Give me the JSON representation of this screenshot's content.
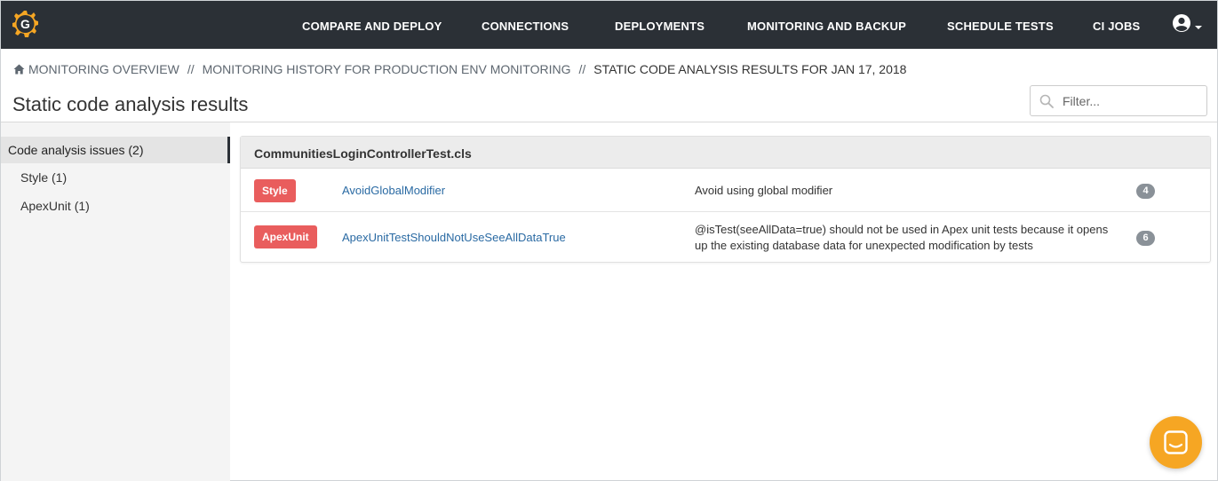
{
  "brand": {
    "logo_letter": "G",
    "logo_color": "#f6a623"
  },
  "nav": {
    "items": [
      {
        "label": "COMPARE AND DEPLOY"
      },
      {
        "label": "CONNECTIONS"
      },
      {
        "label": "DEPLOYMENTS"
      },
      {
        "label": "MONITORING AND BACKUP"
      },
      {
        "label": "SCHEDULE TESTS"
      },
      {
        "label": "CI JOBS"
      }
    ],
    "user_icon": "user-circle-icon"
  },
  "breadcrumb": {
    "items": [
      {
        "label": "MONITORING OVERVIEW"
      },
      {
        "label": "MONITORING HISTORY FOR PRODUCTION ENV MONITORING"
      }
    ],
    "separator": "//",
    "current": "STATIC CODE ANALYSIS RESULTS FOR JAN 17, 2018"
  },
  "page": {
    "title": "Static code analysis results"
  },
  "filter": {
    "placeholder": "Filter..."
  },
  "sidebar": {
    "header": "Code analysis issues (2)",
    "items": [
      {
        "label": "Style (1)"
      },
      {
        "label": "ApexUnit (1)"
      }
    ]
  },
  "results": {
    "file": "CommunitiesLoginControllerTest.cls",
    "issues": [
      {
        "category": "Style",
        "rule": "AvoidGlobalModifier",
        "description": "Avoid using global modifier",
        "line": "4"
      },
      {
        "category": "ApexUnit",
        "rule": "ApexUnitTestShouldNotUseSeeAllDataTrue",
        "description": "@isTest(seeAllData=true) should not be used in Apex unit tests because it opens up the existing database data for unexpected modification by tests",
        "line": "6"
      }
    ]
  },
  "colors": {
    "nav_bg": "#2b3036",
    "badge": "#e95d5d",
    "link": "#2a6aa3",
    "chat": "#f6a623"
  }
}
